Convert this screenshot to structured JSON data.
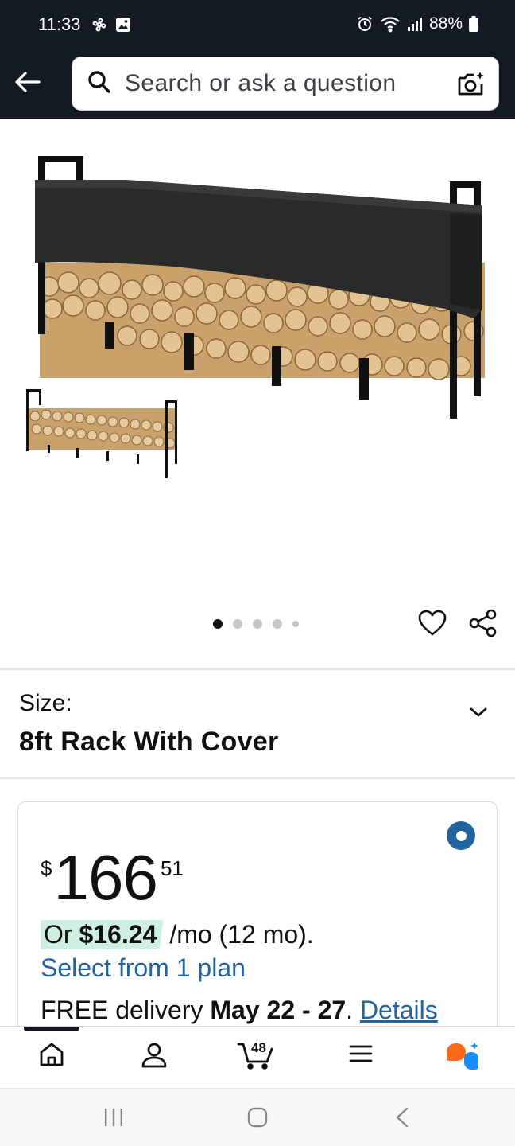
{
  "status_bar": {
    "time": "11:33",
    "battery": "88%"
  },
  "search": {
    "placeholder": "Search or ask a question"
  },
  "gallery": {
    "page_count": 5,
    "active_index": 0
  },
  "size": {
    "label": "Size:",
    "value": "8ft Rack With Cover"
  },
  "price": {
    "currency": "$",
    "whole": "166",
    "fraction": "51",
    "monthly_prefix": "Or",
    "monthly_amount": "$16.24",
    "monthly_suffix": "/mo (12 mo).",
    "plan_link": "Select from 1 plan",
    "delivery_prefix": "FREE delivery",
    "delivery_dates": "May 22 - 27",
    "delivery_dot": ".",
    "details_link": "Details"
  },
  "bottom_nav": {
    "cart_count": "48"
  },
  "colors": {
    "header_bg": "#131a22",
    "link": "#2162a1",
    "highlight": "#cfefe0",
    "text": "#0f1111"
  }
}
